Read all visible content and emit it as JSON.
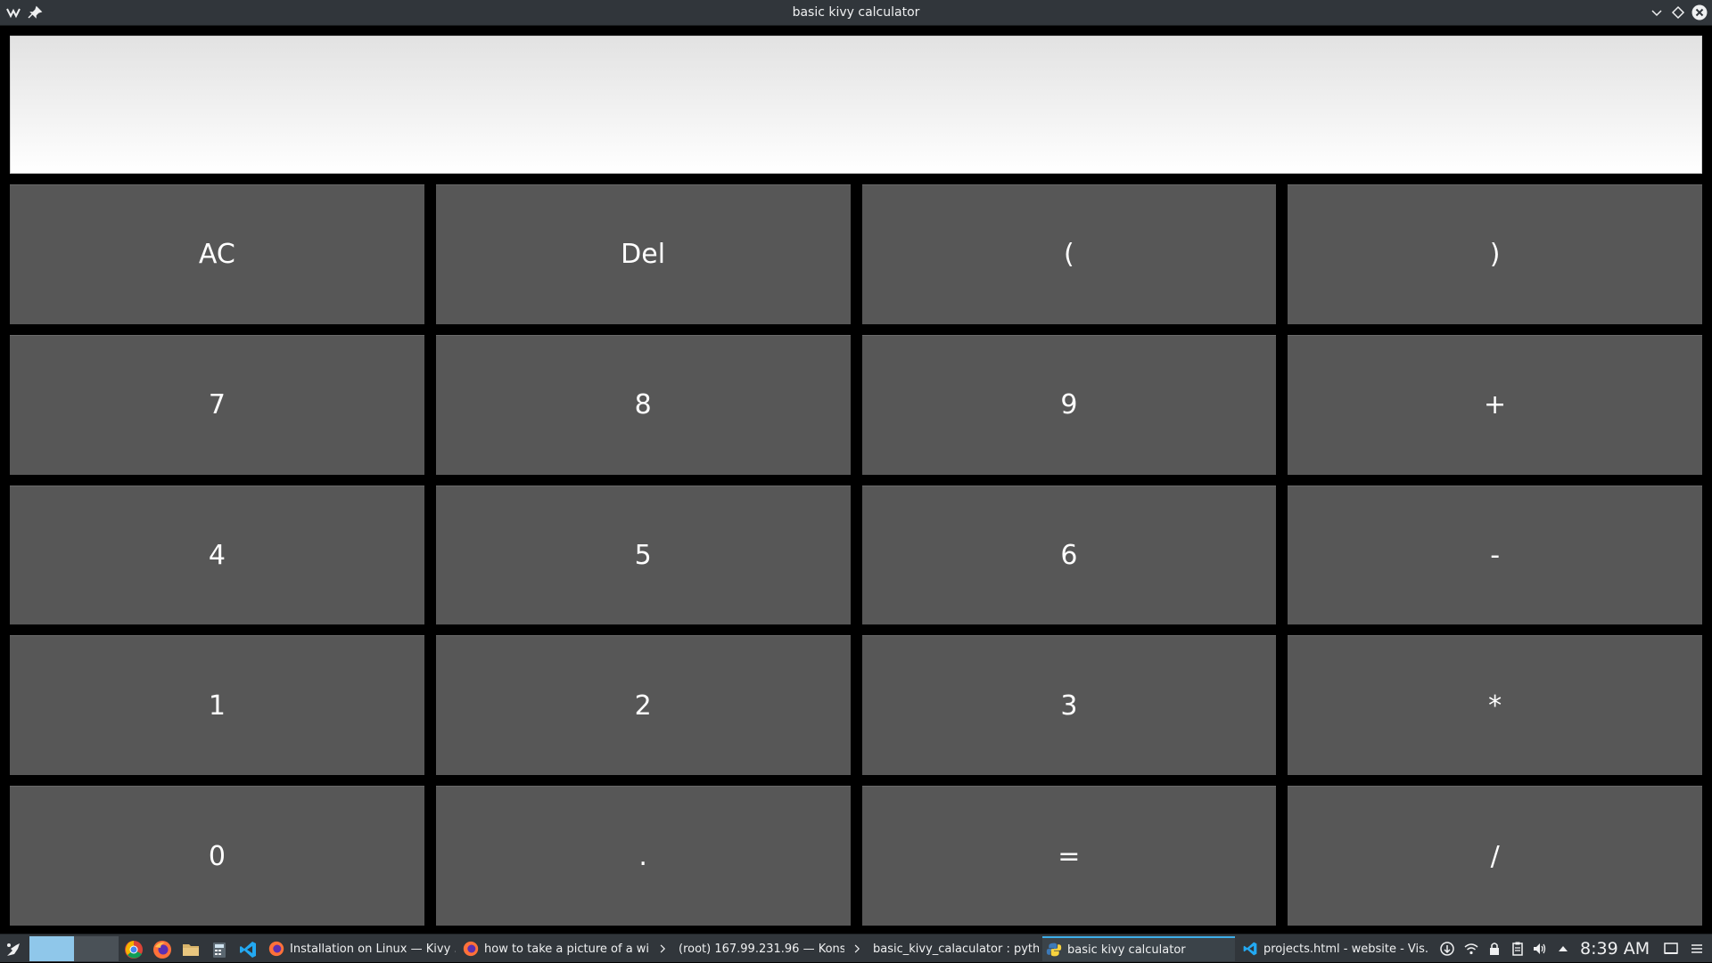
{
  "window": {
    "title": "basic kivy calculator"
  },
  "display": {
    "value": ""
  },
  "keys": [
    [
      "AC",
      "Del",
      "(",
      ")"
    ],
    [
      "7",
      "8",
      "9",
      "+"
    ],
    [
      "4",
      "5",
      "6",
      "-"
    ],
    [
      "1",
      "2",
      "3",
      "*"
    ],
    [
      "0",
      ".",
      "=",
      "/"
    ]
  ],
  "taskbar": {
    "tasks": [
      {
        "label": "Installation on Linux — Kivy ...",
        "icon": "firefox-icon"
      },
      {
        "label": "how to take a picture of a wi...",
        "icon": "firefox-icon"
      },
      {
        "label": "(root) 167.99.231.96 — Kons...",
        "icon": "terminal-icon"
      },
      {
        "label": "basic_kivy_calaculator : pyth...",
        "icon": "terminal-icon"
      },
      {
        "label": "basic kivy calculator",
        "icon": "python-icon",
        "active": true
      },
      {
        "label": "projects.html - website - Vis...",
        "icon": "vscode-icon"
      }
    ],
    "clock": "8:39 AM"
  },
  "colors": {
    "titlebar": "#31363b",
    "key_background": "#575757",
    "key_text": "#ffffff",
    "accent": "#3daee9"
  }
}
